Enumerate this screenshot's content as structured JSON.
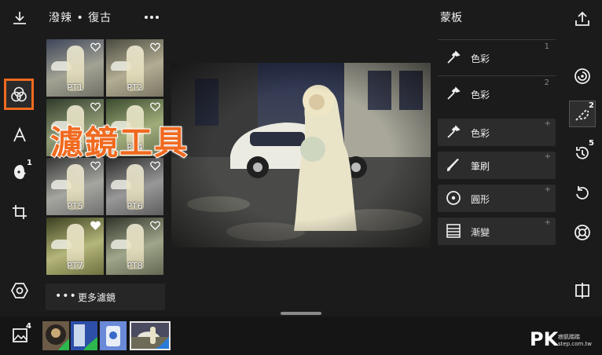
{
  "header": {
    "filter_title": "潑辣 • 復古",
    "more_icon": "ellipsis-icon"
  },
  "left_toolbar": {
    "download_icon": "download-icon",
    "tools": [
      {
        "name": "filter-tool",
        "icon": "overlapping-circles-icon",
        "selected": true
      },
      {
        "name": "text-tool",
        "icon": "letter-a-icon"
      },
      {
        "name": "retouch-tool",
        "icon": "face-icon",
        "badge": "1"
      },
      {
        "name": "crop-tool",
        "icon": "crop-icon"
      },
      {
        "name": "settings-tool",
        "icon": "hexagon-icon"
      }
    ],
    "accent_color": "#f06a20"
  },
  "filters": [
    {
      "label": "PT1"
    },
    {
      "label": "PT2"
    },
    {
      "label": "PT3"
    },
    {
      "label": "PT4"
    },
    {
      "label": "PT5"
    },
    {
      "label": "PT6"
    },
    {
      "label": "PT7"
    },
    {
      "label": "PT8"
    }
  ],
  "more_filters": {
    "dots": "•••",
    "label": "更多濾鏡"
  },
  "overlay_caption": "濾鏡工具",
  "mask_panel": {
    "title": "蒙板",
    "masks": [
      {
        "icon": "eyedropper-icon",
        "label": "色彩",
        "number": "1"
      },
      {
        "icon": "eyedropper-icon",
        "label": "色彩",
        "number": "2"
      }
    ],
    "add_options": [
      {
        "icon": "eyedropper-icon",
        "label": "色彩",
        "plus": "+"
      },
      {
        "icon": "brush-icon",
        "label": "筆刷",
        "plus": "+"
      },
      {
        "icon": "circle-target-icon",
        "label": "圓形",
        "plus": "+"
      },
      {
        "icon": "gradient-icon",
        "label": "漸變",
        "plus": "+"
      }
    ]
  },
  "right_toolbar": {
    "tools": [
      {
        "name": "share",
        "icon": "share-icon"
      },
      {
        "name": "adjust",
        "icon": "spiral-icon"
      },
      {
        "name": "mask",
        "icon": "mask-brush-icon",
        "badge": "2",
        "selected": true
      },
      {
        "name": "history",
        "icon": "clock-arrow-icon",
        "badge": "5"
      },
      {
        "name": "undo",
        "icon": "undo-icon"
      },
      {
        "name": "help",
        "icon": "lifebuoy-icon"
      },
      {
        "name": "compare",
        "icon": "compare-icon"
      }
    ]
  },
  "filmstrip": {
    "gallery_icon": "image-icon",
    "gallery_badge": "4",
    "items": 4,
    "selected_index": 3
  },
  "watermark": {
    "logo": "PK",
    "line1": "痞凱踏踏",
    "line2": "step.com.tw"
  }
}
